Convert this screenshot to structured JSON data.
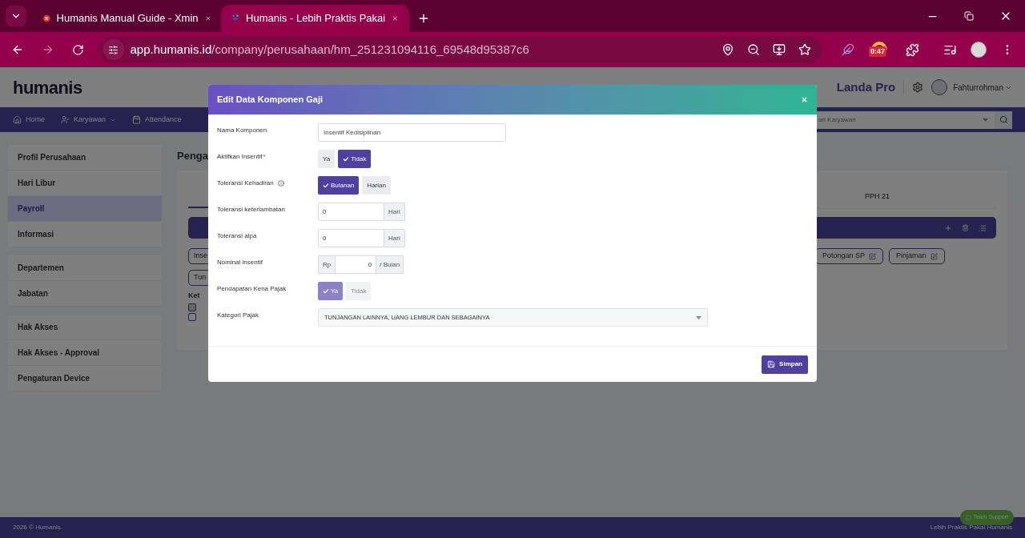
{
  "browser": {
    "tabs": [
      {
        "title": "Humanis Manual Guide - Xmin",
        "selected": false
      },
      {
        "title": "Humanis - Lebih Praktis Pakai",
        "selected": true
      }
    ],
    "url": {
      "host": "app.humanis.id",
      "path": "/company/perusahaan/hm_251231094116_69548d95387c6"
    },
    "extension_badge": "0:47"
  },
  "app": {
    "logo": "humanis",
    "brand": "Landa Pro",
    "user": "Fahturrohman",
    "nav": [
      {
        "label": "Home",
        "dropdown": false
      },
      {
        "label": "Karyawan",
        "dropdown": true
      },
      {
        "label": "Attendance",
        "dropdown": false
      }
    ],
    "search": {
      "placeholder": "ari Karyawan"
    },
    "sidebar": [
      [
        {
          "label": "Profil Perusahaan",
          "selected": false
        },
        {
          "label": "Hari Libur",
          "selected": false
        },
        {
          "label": "Payroll",
          "selected": true
        },
        {
          "label": "Informasi",
          "selected": false
        }
      ],
      [
        {
          "label": "Departemen",
          "selected": false
        },
        {
          "label": "Jabatan",
          "selected": false
        }
      ],
      [
        {
          "label": "Hak Akses",
          "selected": false
        },
        {
          "label": "Hak Akses - Approval",
          "selected": false
        },
        {
          "label": "Pengaturan Device",
          "selected": false
        }
      ]
    ],
    "page_title": "Penga",
    "tab": "PPH 21",
    "chips_left": [
      "Inse",
      "Tun"
    ],
    "chips_right": [
      "Potongan SP",
      "Pinjaman"
    ],
    "legend_title": "Ket"
  },
  "footer": {
    "left": "2026 © Humanis.",
    "right": "Lebih Praktis Pakai Humanis",
    "support": "Team Support"
  },
  "modal": {
    "title": "Edit Data Komponen Gaji",
    "fields": [
      {
        "kind": "text",
        "label": "Nama Komponen",
        "value": "Insentif Kedisiplinan"
      },
      {
        "kind": "toggle",
        "label": "Aktifkan Insentif",
        "required_mark": "*",
        "disabled": false,
        "options": [
          {
            "label": "Ya",
            "selected": false
          },
          {
            "label": "Tidak",
            "selected": true
          }
        ]
      },
      {
        "kind": "toggle",
        "label": "Toleransi Kehadiran",
        "info": true,
        "disabled": false,
        "options": [
          {
            "label": "Bulanan",
            "selected": true
          },
          {
            "label": "Harian",
            "selected": false
          }
        ]
      },
      {
        "kind": "addon",
        "label": "Toleransi keterlambatan",
        "value": "0",
        "suffix": "Hari"
      },
      {
        "kind": "addon",
        "label": "Toleransi alpa",
        "value": "0",
        "suffix": "Hari"
      },
      {
        "kind": "currency",
        "label": "Nominal insentif",
        "prefix": "Rp",
        "value": "0",
        "suffix": "/ Bulan"
      },
      {
        "kind": "toggle",
        "label": "Pendapatan Kena Pajak",
        "disabled": true,
        "options": [
          {
            "label": "Ya",
            "selected": true
          },
          {
            "label": "Tidak",
            "selected": false
          }
        ]
      },
      {
        "kind": "select",
        "label": "Kategori Pajak",
        "value": "TUNJANGAN LAINNYA, UANG LEMBUR DAN SEBAGAINYA"
      }
    ],
    "save": "Simpan"
  }
}
